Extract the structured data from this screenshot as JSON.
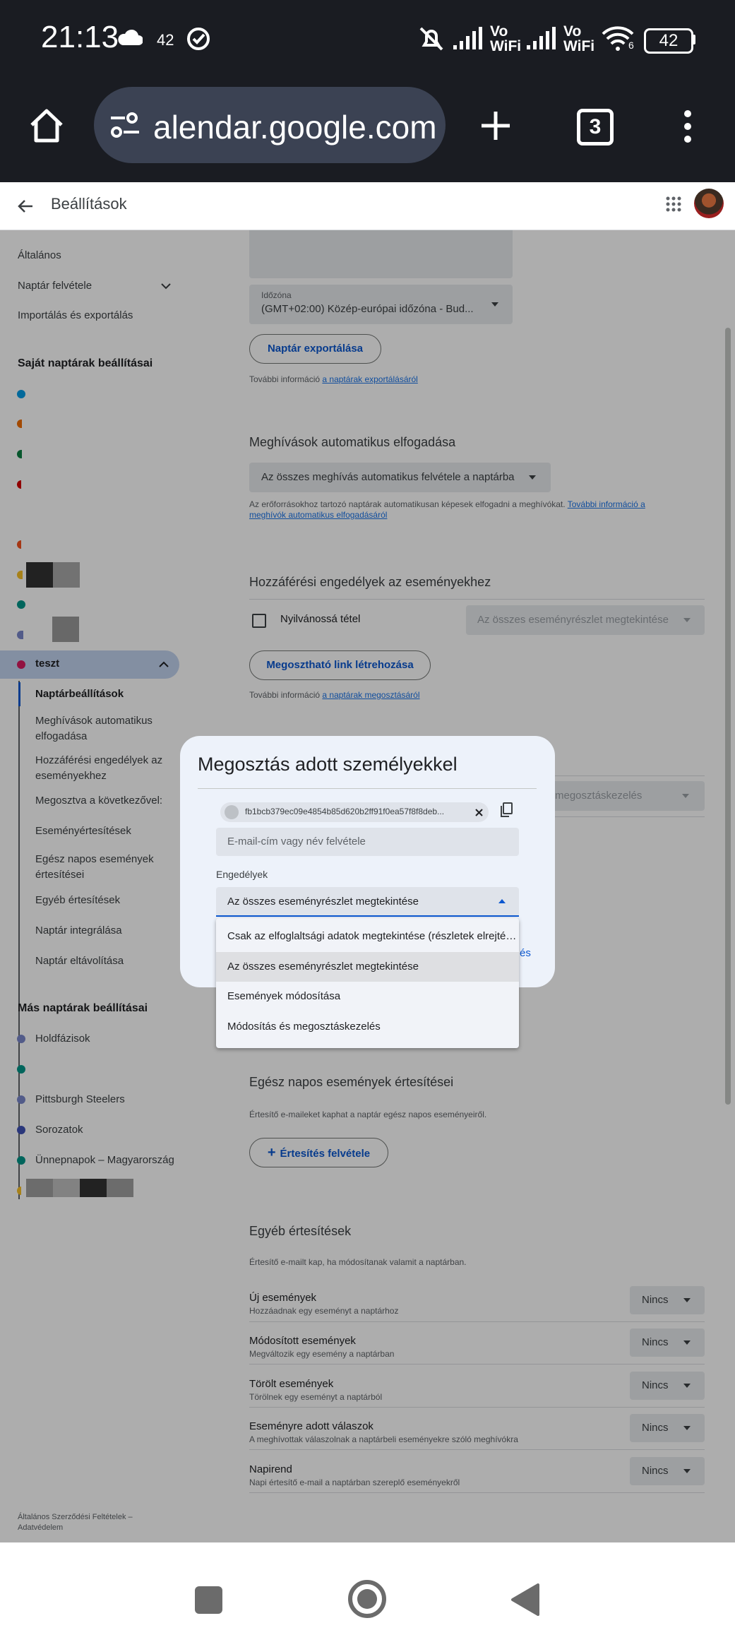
{
  "status_bar": {
    "time": "21:13",
    "weather_value": "42",
    "battery": "42",
    "wifi_label_1": "Vo\nWiFi",
    "wifi_label_2": "Vo\nWiFi",
    "wifi_number": "6"
  },
  "browser": {
    "url": "alendar.google.com",
    "tab_count": "3"
  },
  "header": {
    "title": "Beállítások"
  },
  "sidebar": {
    "items": [
      "Általános",
      "Naptár felvétele",
      "Importálás és exportálás"
    ],
    "my_calendars_heading": "Saját naptárak beállításai",
    "selected_calendar": "teszt",
    "sub_items": [
      "Naptárbeállítások",
      "Meghívások automatikus elfogadása",
      "Hozzáférési engedélyek az eseményekhez",
      "Megosztva a következővel:",
      "Eseményértesítések",
      "Egész napos események értesítései",
      "Egyéb értesítések",
      "Naptár integrálása",
      "Naptár eltávolítása"
    ],
    "other_calendars_heading": "Más naptárak beállításai",
    "other_calendars": [
      "Holdfázisok",
      "Pittsburgh Steelers",
      "Sorozatok",
      "Ünnepnapok – Magyarország"
    ],
    "footer": "Általános Szerződési Feltételek – Adatvédelem",
    "colors": {
      "blue": "#039be5",
      "orange": "#ef6c00",
      "green": "#0b8043",
      "red": "#d50000",
      "lavender": "#7986cb",
      "teal": "#009688",
      "purple": "#8e24aa",
      "grape": "#3f51b5",
      "pink": "#d81b60",
      "yellow": "#f6bf26"
    }
  },
  "main": {
    "timezone_label": "Időzóna",
    "timezone_value": "(GMT+02:00) Közép-európai időzóna - Bud...",
    "export_button": "Naptár exportálása",
    "export_info_prefix": "További információ",
    "export_info_link": "a naptárak exportálásáról",
    "auto_accept_heading": "Meghívások automatikus elfogadása",
    "auto_accept_value": "Az összes meghívás automatikus felvétele a naptárba",
    "auto_accept_info": "Az erőforrásokhoz tartozó naptárak automatikusan képesek elfogadni a meghívókat.",
    "auto_accept_info_link": "További információ a meghívók automatikus elfogadásáról",
    "access_heading": "Hozzáférési engedélyek az eseményekhez",
    "public_label": "Nyilvánossá tétel",
    "public_select": "Az összes eseményrészlet megtekintése",
    "share_link_button": "Megosztható link létrehozása",
    "share_info_prefix": "További információ",
    "share_info_link": "a naptárak megosztásáról",
    "shared_with_select_partial": "megosztáskezelés",
    "allday_heading": "Egész napos események értesítései",
    "allday_info": "Értesítő e-maileket kaphat a naptár egész napos eseményeiről.",
    "add_notification_button": "Értesítés felvétele",
    "other_heading": "Egyéb értesítések",
    "other_info": "Értesítő e-mailt kap, ha módosítanak valamit a naptárban.",
    "notifications": [
      {
        "title": "Új események",
        "desc": "Hozzáadnak egy eseményt a naptárhoz",
        "value": "Nincs"
      },
      {
        "title": "Módosított események",
        "desc": "Megváltozik egy esemény a naptárban",
        "value": "Nincs"
      },
      {
        "title": "Törölt események",
        "desc": "Törölnek egy eseményt a naptárból",
        "value": "Nincs"
      },
      {
        "title": "Eseményre adott válaszok",
        "desc": "A meghívottak válaszolnak a naptárbeli eseményekre szóló meghívókra",
        "value": "Nincs"
      },
      {
        "title": "Napirend",
        "desc": "Napi értesítő e-mail a naptárban szereplő eseményekről",
        "value": "Nincs"
      }
    ]
  },
  "dialog": {
    "title": "Megosztás adott személyekkel",
    "chip": "fb1bcb379ec09e4854b85d620b2ff91f0ea57f8f8deb...",
    "input_placeholder": "E-mail-cím vagy név felvétele",
    "permissions_label": "Engedélyek",
    "permissions_value": "Az összes eseményrészlet megtekintése",
    "partial_button": "és",
    "options": [
      "Csak az elfoglaltsági adatok megtekintése (részletek elrejtése)",
      "Az összes eseményrészlet megtekintése",
      "Események módosítása",
      "Módosítás és megosztáskezelés"
    ],
    "selected_option": 1
  }
}
